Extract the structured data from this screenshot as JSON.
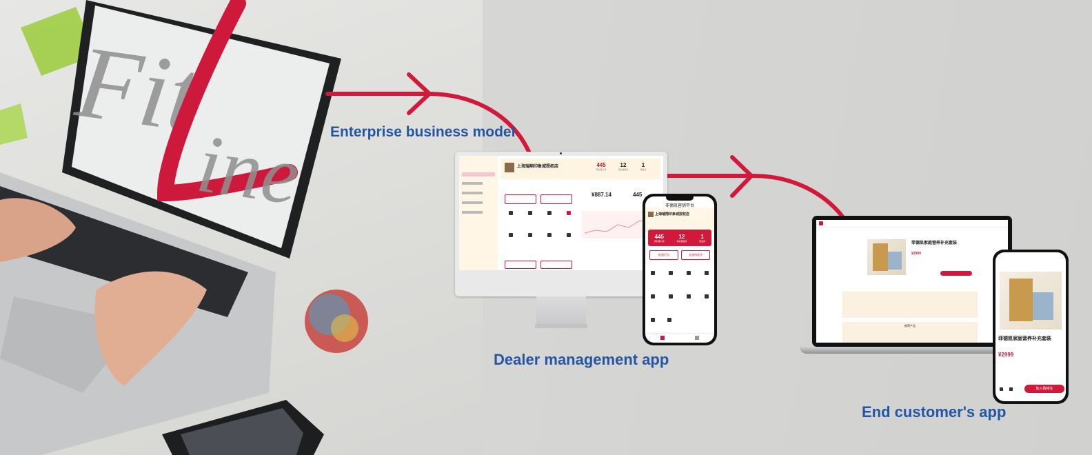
{
  "labels": {
    "enterprise": "Enterprise business model",
    "dealer": "Dealer management app",
    "customer": "End customer's app"
  },
  "brand": {
    "logo_text": "FitLine",
    "accent": "#d0193b",
    "label_color": "#2356a4"
  },
  "dealer_app": {
    "shop_name": "上海瑞翔印象城授权店",
    "phone_title": "非德凯营销平台",
    "stats": [
      {
        "value": "445",
        "label": "待处理订单"
      },
      {
        "value": "12",
        "label": "待处理退款"
      },
      {
        "value": "1",
        "label": "待发货"
      }
    ],
    "revenue": "¥887.14",
    "revenue_count": "445",
    "buttons": [
      "批量打包",
      "全部待发货"
    ]
  },
  "customer_app": {
    "product_title": "菲德凯家庭营养补充套装",
    "price": "¥2999",
    "add_to_cart": "加入购物车",
    "recommended": "推荐产品"
  }
}
